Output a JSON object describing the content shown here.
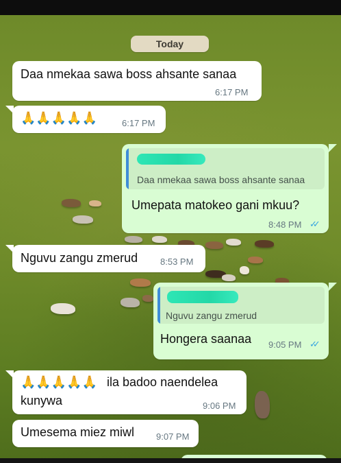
{
  "date_chip": "Today",
  "messages": [
    {
      "text": "Daa nmekaa sawa boss ahsante sanaa",
      "time": "6:17 PM"
    },
    {
      "emoji": "🙏🙏🙏🙏🙏",
      "time": "6:17 PM"
    },
    {
      "quoted_text": "Daa nmekaa sawa boss ahsante sanaa",
      "text": "Umepata matokeo gani mkuu?",
      "time": "8:48 PM",
      "ticks": "✓✓"
    },
    {
      "text": "Nguvu zangu zmerud",
      "time": "8:53 PM"
    },
    {
      "quoted_text": "Nguvu zangu zmerud",
      "text": "Hongera saanaa",
      "time": "9:05 PM",
      "ticks": "✓✓"
    },
    {
      "emoji": "🙏🙏🙏🙏🙏",
      "text": "ila badoo naendelea",
      "text2": "kunywa",
      "time": "9:06 PM"
    },
    {
      "text": "Umesema miez miwl",
      "time": "9:07 PM"
    }
  ],
  "colors": {
    "incoming": "#ffffff",
    "outgoing": "#d9fdd3",
    "read_ticks": "#34a3e0",
    "quote_bar": "#3e8dd8"
  }
}
